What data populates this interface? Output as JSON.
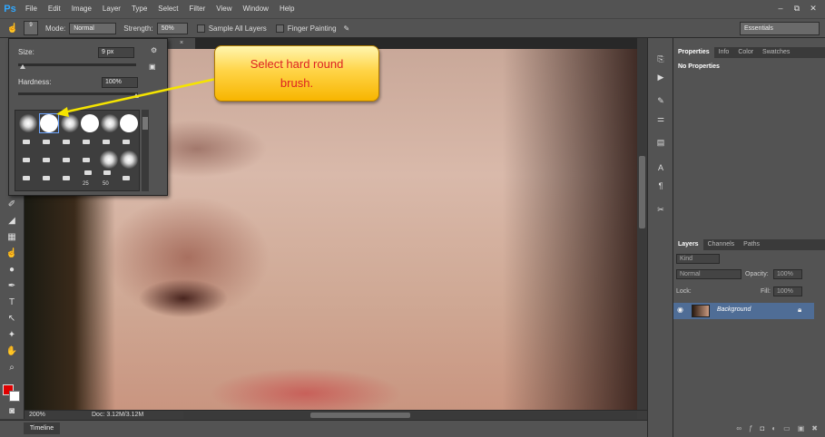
{
  "app": {
    "logo": "Ps"
  },
  "menu": [
    "File",
    "Edit",
    "Image",
    "Layer",
    "Type",
    "Select",
    "Filter",
    "View",
    "Window",
    "Help"
  ],
  "window_controls": [
    "–",
    "⧉",
    "✕"
  ],
  "options_bar": {
    "brush_size_badge": "9",
    "mode_label": "Mode:",
    "mode_value": "Normal",
    "strength_label": "Strength:",
    "strength_value": "50%",
    "sample_all_layers": "Sample All Layers",
    "finger_painting": "Finger Painting",
    "workspace": "Essentials"
  },
  "document_tab": "×",
  "brush_picker": {
    "size_label": "Size:",
    "size_value": "9 px",
    "hardness_label": "Hardness:",
    "hardness_value": "100%",
    "preset_numbers": [
      "25",
      "50"
    ]
  },
  "callout": {
    "text_line1": "Select hard round",
    "text_line2": "brush."
  },
  "status": {
    "zoom": "200%",
    "doc": "Doc: 3.12M/3.12M"
  },
  "timeline": {
    "label": "Timeline"
  },
  "properties_panel": {
    "tabs": [
      "Properties",
      "Info",
      "Color",
      "Swatches"
    ],
    "empty_text": "No Properties"
  },
  "layers_panel": {
    "tabs": [
      "Layers",
      "Channels",
      "Paths"
    ],
    "filter_value": "Kind",
    "blend_value": "Normal",
    "opacity_label": "Opacity:",
    "opacity_value": "100%",
    "lock_label": "Lock:",
    "fill_label": "Fill:",
    "fill_value": "100%",
    "layer_name": "Background"
  },
  "colors": {
    "foreground": "#e00000",
    "background": "#ffffff",
    "accent": "#31a8ff"
  }
}
